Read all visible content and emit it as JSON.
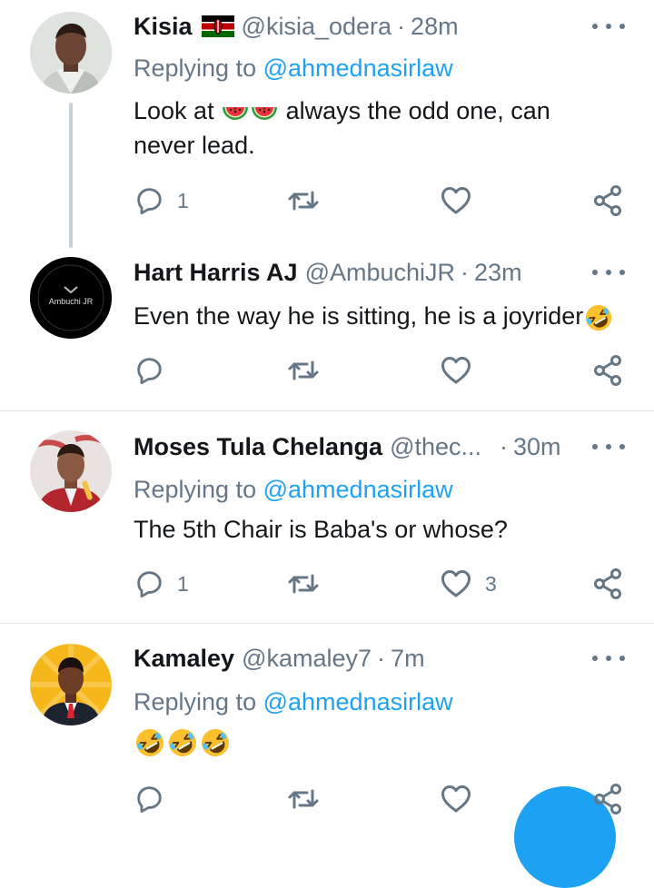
{
  "colors": {
    "text": "#14171a",
    "secondary": "#657786",
    "link": "#1da1f2",
    "divider": "#dfe3e8",
    "thread_line": "#c9d0d6"
  },
  "tweets": [
    {
      "name": "Kisia",
      "name_emoji": "kenya-flag-emoji",
      "handle": "@kisia_odera",
      "time": "28m",
      "replying_prefix": "Replying to",
      "replying_handle": "@ahmednasirlaw",
      "text_before_emoji": "Look at",
      "text_emojis": [
        "watermelon-emoji",
        "watermelon-emoji"
      ],
      "text_after_emoji": "always the odd one, can",
      "text_line2": "never lead.",
      "reply_count": "1",
      "retweet_count": "",
      "like_count": ""
    },
    {
      "name": "Hart Harris AJ",
      "handle": "@AmbuchiJR",
      "time": "23m",
      "avatar_text": "Ambuchi JR",
      "text": "Even the way he is sitting, he is a joyrider",
      "text_emoji": "rolling-on-floor-laughing-emoji",
      "reply_count": "",
      "retweet_count": "",
      "like_count": ""
    },
    {
      "name": "Moses Tula Chelanga",
      "handle": "@thec...",
      "time": "30m",
      "replying_prefix": "Replying to",
      "replying_handle": "@ahmednasirlaw",
      "text": "The 5th Chair is Baba's or whose?",
      "reply_count": "1",
      "retweet_count": "",
      "like_count": "3"
    },
    {
      "name": "Kamaley",
      "handle": "@kamaley7",
      "time": "7m",
      "replying_prefix": "Replying to",
      "replying_handle": "@ahmednasirlaw",
      "text_emojis": [
        "rolling-on-floor-laughing-emoji",
        "rolling-on-floor-laughing-emoji",
        "rolling-on-floor-laughing-emoji"
      ],
      "reply_count": "",
      "retweet_count": "",
      "like_count": ""
    }
  ],
  "icons": {
    "reply": "reply-icon",
    "retweet": "retweet-icon",
    "like": "heart-icon",
    "share": "share-icon",
    "more": "more-options-icon",
    "compose": "compose-fab"
  }
}
